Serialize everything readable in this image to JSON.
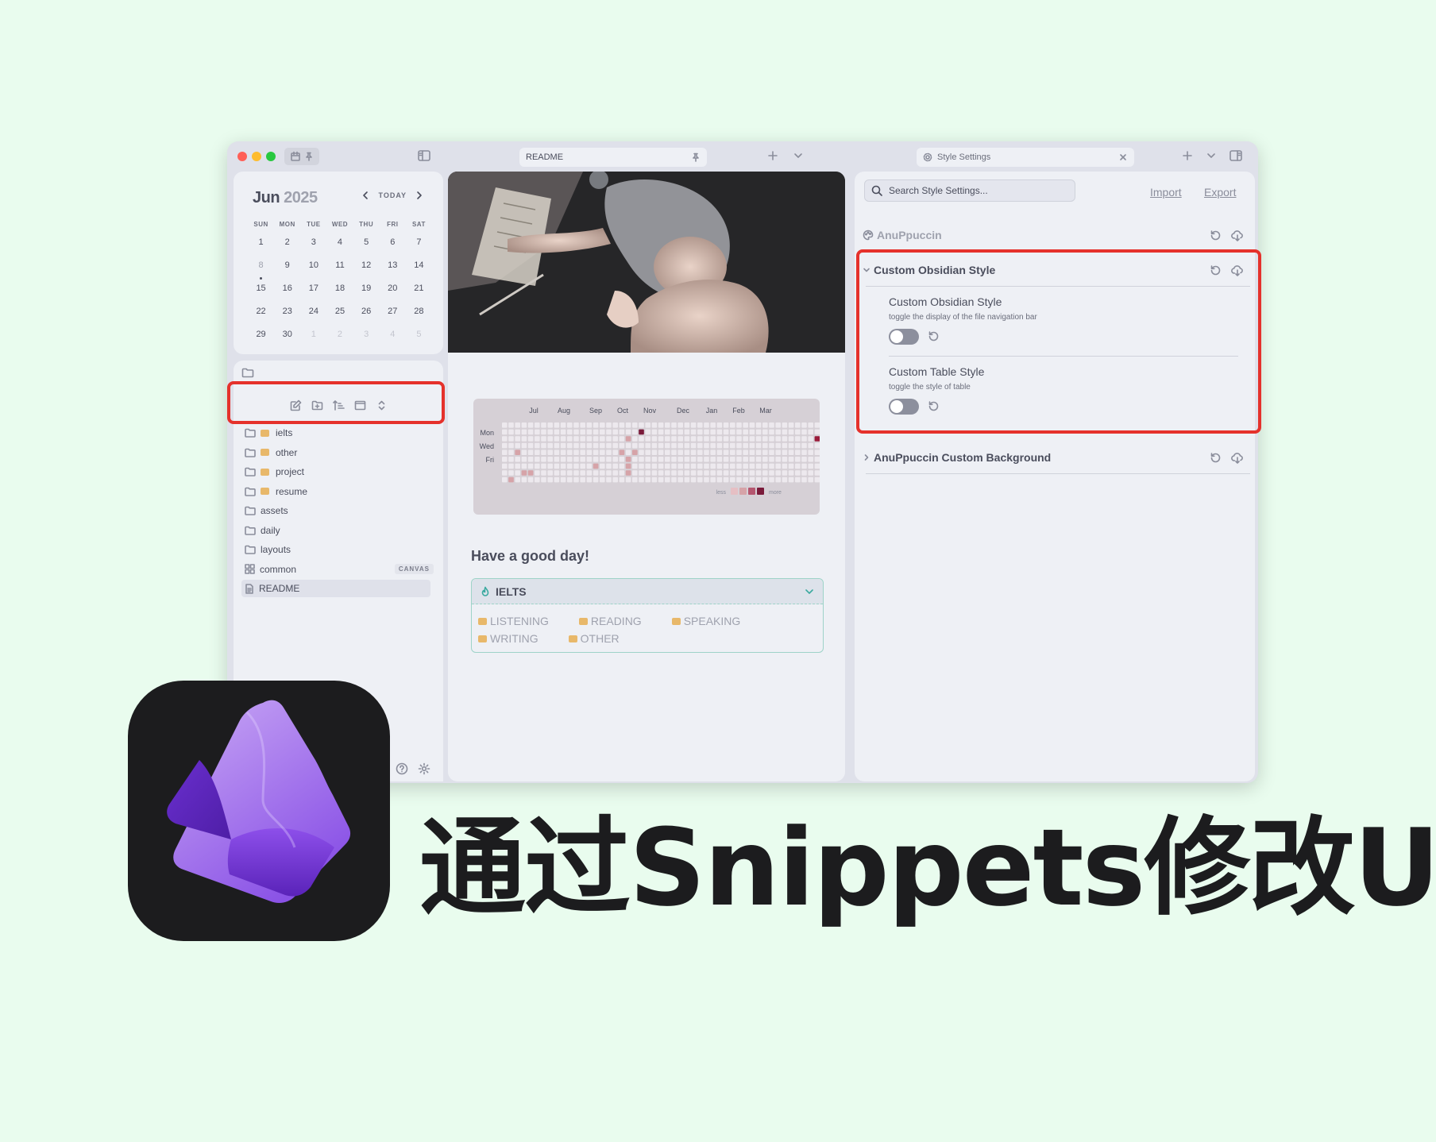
{
  "window": {
    "tab_center": "README",
    "tab_right": "Style Settings"
  },
  "calendar": {
    "month": "Jun",
    "year": "2025",
    "today_label": "TODAY",
    "weekdays": [
      "SUN",
      "MON",
      "TUE",
      "WED",
      "THU",
      "FRI",
      "SAT"
    ],
    "days": [
      "1",
      "2",
      "3",
      "4",
      "5",
      "6",
      "7",
      "8",
      "9",
      "10",
      "11",
      "12",
      "13",
      "14",
      "15",
      "16",
      "17",
      "18",
      "19",
      "20",
      "21",
      "22",
      "23",
      "24",
      "25",
      "26",
      "27",
      "28",
      "29",
      "30",
      "1",
      "2",
      "3",
      "4",
      "5"
    ]
  },
  "file_tree": [
    {
      "label": "ielts",
      "emoji": true
    },
    {
      "label": "other",
      "emoji": true
    },
    {
      "label": "project",
      "emoji": true
    },
    {
      "label": "resume",
      "emoji": true
    },
    {
      "label": "assets"
    },
    {
      "label": "daily"
    },
    {
      "label": "layouts"
    },
    {
      "label": "common",
      "badge": "CANVAS"
    },
    {
      "label": "README"
    }
  ],
  "heatmap": {
    "months": [
      "Jul",
      "Aug",
      "Sep",
      "Oct",
      "Nov",
      "Dec",
      "Jan",
      "Feb",
      "Mar"
    ],
    "weekdays": [
      "Mon",
      "Wed",
      "Fri"
    ],
    "less": "less",
    "more": "more"
  },
  "note": {
    "greeting": "Have a good day!",
    "callout_title": "IELTS",
    "callout_items": [
      "LISTENING",
      "READING",
      "SPEAKING",
      "WRITING",
      "OTHER"
    ]
  },
  "style_settings": {
    "search_placeholder": "Search Style Settings...",
    "import": "Import",
    "export": "Export",
    "sections": [
      {
        "title": "AnuPpuccin"
      },
      {
        "title": "Custom Obsidian Style",
        "settings": [
          {
            "name": "Custom Obsidian Style",
            "desc": "toggle the display of the file navigation bar"
          },
          {
            "name": "Custom Table Style",
            "desc": "toggle the style of table"
          }
        ]
      },
      {
        "title": "AnuPpuccin Custom Background"
      }
    ]
  },
  "headline": "通过Snippets修改UI",
  "colors": {
    "background": "#e9fcee",
    "highlight": "#e5312b",
    "accent": "#7d3ad6"
  }
}
